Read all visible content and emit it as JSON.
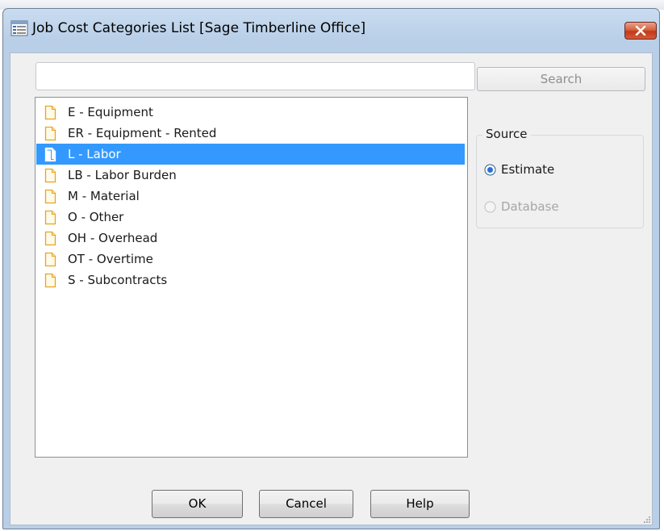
{
  "window": {
    "title": "Job Cost Categories List [Sage Timberline Office]"
  },
  "search": {
    "value": "",
    "button_label": "Search"
  },
  "categories": [
    {
      "label": "E - Equipment",
      "selected": false
    },
    {
      "label": "ER - Equipment - Rented",
      "selected": false
    },
    {
      "label": "L - Labor",
      "selected": true
    },
    {
      "label": "LB - Labor Burden",
      "selected": false
    },
    {
      "label": "M - Material",
      "selected": false
    },
    {
      "label": "O - Other",
      "selected": false
    },
    {
      "label": "OH - Overhead",
      "selected": false
    },
    {
      "label": "OT - Overtime",
      "selected": false
    },
    {
      "label": "S - Subcontracts",
      "selected": false
    }
  ],
  "source": {
    "label": "Source",
    "options": [
      {
        "label": "Estimate",
        "checked": true,
        "enabled": true
      },
      {
        "label": "Database",
        "checked": false,
        "enabled": false
      }
    ]
  },
  "buttons": {
    "ok": "OK",
    "cancel": "Cancel",
    "help": "Help"
  },
  "icons": {
    "app": "list-window-icon",
    "close": "close-icon",
    "item": "document-icon"
  },
  "colors": {
    "selection": "#3399ff",
    "close_button": "#c9452a",
    "radio_checked": "#2a6fd6"
  }
}
